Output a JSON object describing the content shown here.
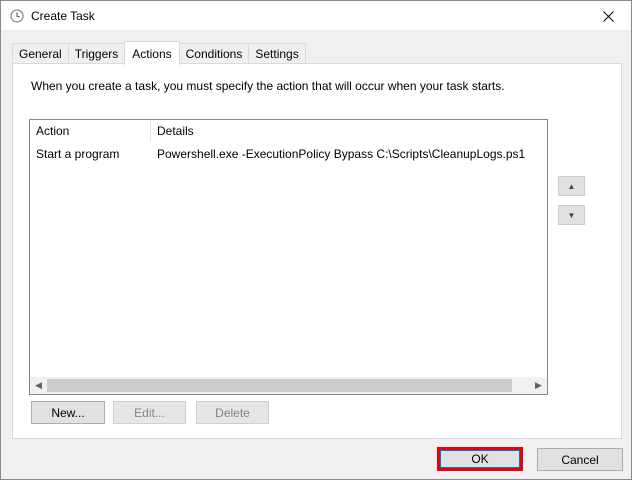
{
  "window": {
    "title": "Create Task",
    "title_icon": "task-scheduler-clock-icon",
    "close_icon": "close-icon"
  },
  "tabs": [
    {
      "label": "General",
      "active": false
    },
    {
      "label": "Triggers",
      "active": false
    },
    {
      "label": "Actions",
      "active": true
    },
    {
      "label": "Conditions",
      "active": false
    },
    {
      "label": "Settings",
      "active": false
    }
  ],
  "actions_panel": {
    "description": "When you create a task, you must specify the action that will occur when your task starts.",
    "columns": [
      "Action",
      "Details"
    ],
    "rows": [
      {
        "action": "Start a program",
        "details": "Powershell.exe -ExecutionPolicy Bypass C:\\Scripts\\CleanupLogs.ps1"
      }
    ],
    "move_up_icon": "triangle-up-icon",
    "move_down_icon": "triangle-down-icon",
    "buttons": {
      "new": "New...",
      "edit": "Edit...",
      "delete": "Delete"
    }
  },
  "footer": {
    "ok": "OK",
    "cancel": "Cancel"
  },
  "colors": {
    "highlight_border": "#e8000b",
    "focus_border": "#0078d7"
  }
}
